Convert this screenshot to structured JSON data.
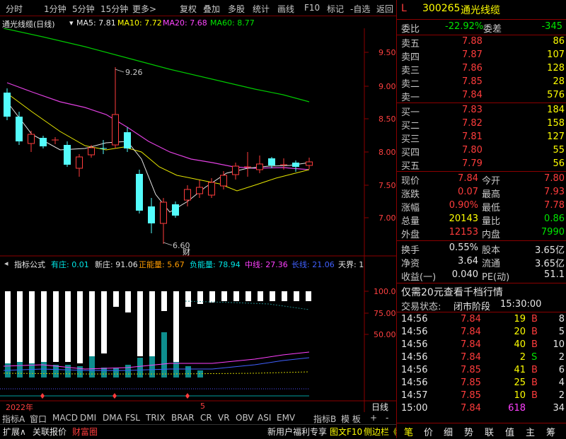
{
  "toolbar": {
    "left": [
      "分时",
      "1分钟",
      "5分钟",
      "15分钟",
      "更多>"
    ],
    "right": [
      "复权",
      "叠加",
      "多股",
      "统计",
      "画线",
      "F10",
      "标记",
      "-自选",
      "返回"
    ]
  },
  "chart": {
    "name": "通光线缆(日线)",
    "ma5": "MA5: 7.81",
    "ma10": "MA10: 7.72",
    "ma20": "MA20: 7.68",
    "ma60": "MA60: 8.77",
    "price_axis": [
      "9.50",
      "9.00",
      "8.50",
      "8.00",
      "7.50",
      "7.00"
    ],
    "high_mark": "9.26",
    "low_mark": "6.60",
    "cai": "财"
  },
  "indicator": {
    "title": "指标公式",
    "youzhuang": "有庄: 0.01",
    "xinzhuang": "新庄: 91.06",
    "zhengnengliang": "正能量: 5.67",
    "funengliang": "负能量: 78.94",
    "zhongxian": "中线: 27.36",
    "changxian": "长线: 21.06",
    "tianjie": "天界: 1",
    "axis": [
      "100.0",
      "75.00",
      "50.00"
    ]
  },
  "xaxis": {
    "year": "2022年",
    "mid": "5",
    "period": "日线"
  },
  "tabs_row1": [
    "指标A",
    "窗口",
    "MACD",
    "DMI",
    "DMA",
    "FSL",
    "TRIX",
    "BRAR",
    "CR",
    "VR",
    "OBV",
    "ASI",
    "EMV"
  ],
  "tabs_row1_right": [
    "指标B",
    "模 板",
    "+",
    "-"
  ],
  "tabs_row2": [
    "扩展∧",
    "关联报价",
    "财富圈"
  ],
  "tabs_row2_right": [
    "新用户福利专享",
    "图文F10",
    "侧边栏《"
  ],
  "right_tabs": [
    "笔",
    "价",
    "细",
    "势",
    "联",
    "值",
    "主",
    "筹"
  ],
  "stock": {
    "code": "300265",
    "name": "通光线缆",
    "flag": "L"
  },
  "weibi": {
    "label": "委比",
    "value": "-22.92%",
    "label2": "委差",
    "value2": "-345"
  },
  "asks": [
    {
      "label": "卖五",
      "price": "7.88",
      "vol": "86"
    },
    {
      "label": "卖四",
      "price": "7.87",
      "vol": "107"
    },
    {
      "label": "卖三",
      "price": "7.86",
      "vol": "128"
    },
    {
      "label": "卖二",
      "price": "7.85",
      "vol": "28"
    },
    {
      "label": "卖一",
      "price": "7.84",
      "vol": "576"
    }
  ],
  "bids": [
    {
      "label": "买一",
      "price": "7.83",
      "vol": "184"
    },
    {
      "label": "买二",
      "price": "7.82",
      "vol": "158"
    },
    {
      "label": "买三",
      "price": "7.81",
      "vol": "127"
    },
    {
      "label": "买四",
      "price": "7.80",
      "vol": "55"
    },
    {
      "label": "买五",
      "price": "7.79",
      "vol": "56"
    }
  ],
  "quote": [
    {
      "l1": "现价",
      "v1": "7.84",
      "l2": "今开",
      "v2": "7.80"
    },
    {
      "l1": "涨跌",
      "v1": "0.07",
      "l2": "最高",
      "v2": "7.93"
    },
    {
      "l1": "涨幅",
      "v1": "0.90%",
      "l2": "最低",
      "v2": "7.78"
    },
    {
      "l1": "总量",
      "v1": "20143",
      "l2": "量比",
      "v2": "0.86"
    },
    {
      "l1": "外盘",
      "v1": "12153",
      "l2": "内盘",
      "v2": "7990"
    }
  ],
  "fundamentals": [
    {
      "l1": "换手",
      "v1": "0.55%",
      "l2": "股本",
      "v2": "3.65亿"
    },
    {
      "l1": "净资",
      "v1": "3.64",
      "l2": "流通",
      "v2": "3.65亿"
    },
    {
      "l1": "收益(一)",
      "v1": "0.040",
      "l2": "PE(动)",
      "v2": "51.1"
    }
  ],
  "promo": "仅需20元查看千档行情",
  "status": {
    "label": "交易状态:",
    "value": "闭市阶段",
    "time": "15:30:00"
  },
  "ticks": [
    {
      "t": "14:56",
      "p": "7.84",
      "v": "19",
      "d": "B",
      "n": "8"
    },
    {
      "t": "14:56",
      "p": "7.84",
      "v": "20",
      "d": "B",
      "n": "5"
    },
    {
      "t": "14:56",
      "p": "7.84",
      "v": "40",
      "d": "B",
      "n": "10"
    },
    {
      "t": "14:56",
      "p": "7.84",
      "v": "2",
      "d": "S",
      "n": "2"
    },
    {
      "t": "14:56",
      "p": "7.85",
      "v": "41",
      "d": "B",
      "n": "6"
    },
    {
      "t": "14:56",
      "p": "7.85",
      "v": "25",
      "d": "B",
      "n": "4"
    },
    {
      "t": "14:57",
      "p": "7.85",
      "v": "10",
      "d": "B",
      "n": "2"
    },
    {
      "t": "15:00",
      "p": "7.84",
      "v": "618",
      "d": "",
      "n": "34"
    }
  ]
}
